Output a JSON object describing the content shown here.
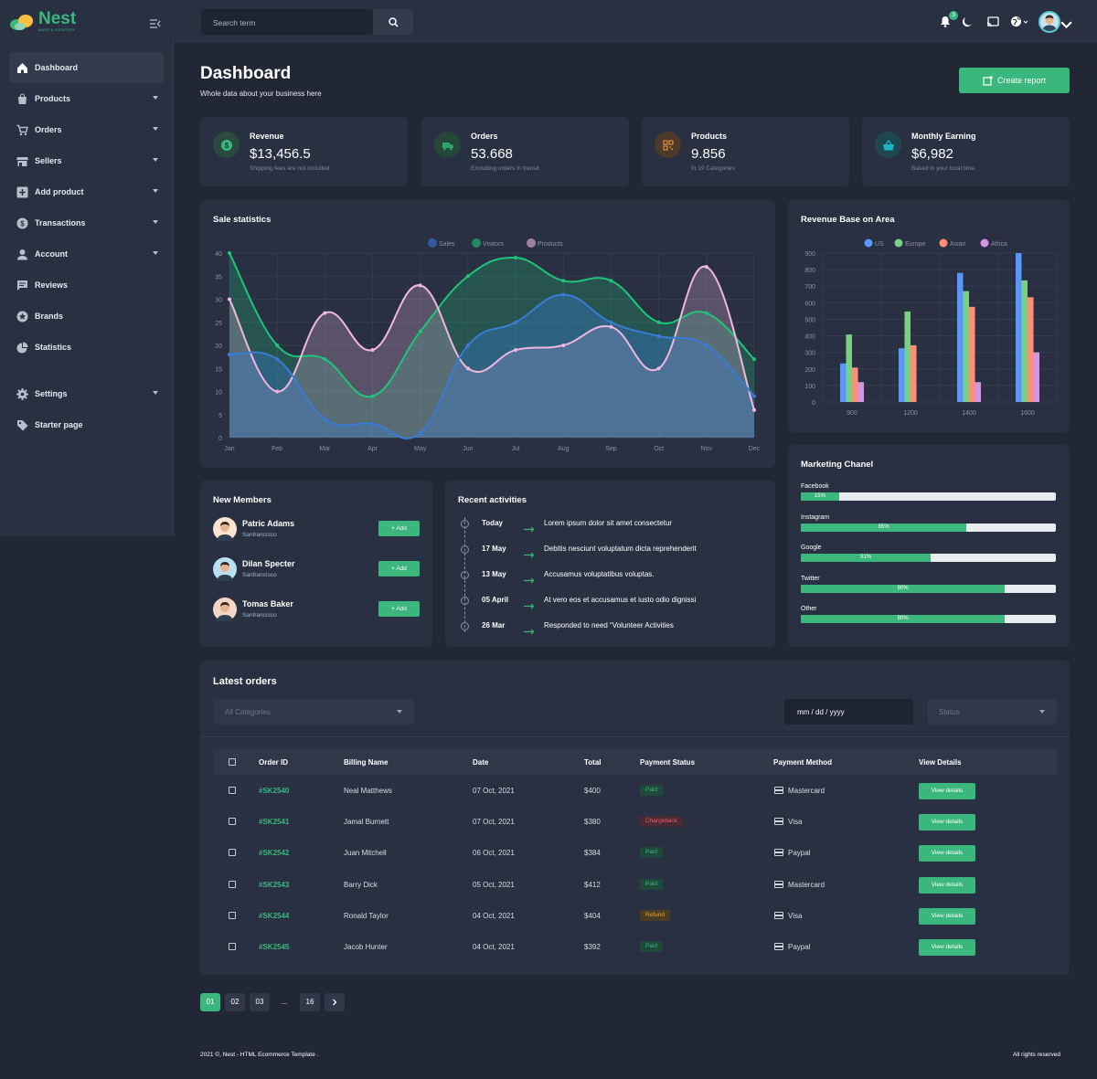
{
  "brand": {
    "name": "Nest",
    "tagline": "MART & GROCERY"
  },
  "sidebar": {
    "items": [
      {
        "label": "Dashboard",
        "icon": "home-icon",
        "active": true,
        "has_sub": false
      },
      {
        "label": "Products",
        "icon": "bag-icon",
        "has_sub": true
      },
      {
        "label": "Orders",
        "icon": "cart-icon",
        "has_sub": true
      },
      {
        "label": "Sellers",
        "icon": "store-icon",
        "has_sub": true
      },
      {
        "label": "Add product",
        "icon": "plus-box-icon",
        "has_sub": true
      },
      {
        "label": "Transactions",
        "icon": "dollar-icon",
        "has_sub": true
      },
      {
        "label": "Account",
        "icon": "person-icon",
        "has_sub": true
      },
      {
        "label": "Reviews",
        "icon": "comment-icon",
        "has_sub": false
      },
      {
        "label": "Brands",
        "icon": "star-icon",
        "has_sub": false
      },
      {
        "label": "Statistics",
        "icon": "pie-icon",
        "has_sub": false
      }
    ],
    "items2": [
      {
        "label": "Settings",
        "icon": "gear-icon",
        "has_sub": true
      },
      {
        "label": "Starter page",
        "icon": "tag-icon",
        "has_sub": false
      }
    ]
  },
  "topbar": {
    "search_placeholder": "Search term",
    "notification_count": "3"
  },
  "header": {
    "title": "Dashboard",
    "subtitle": "Whole data about your business here",
    "create_label": "Create report"
  },
  "kpis": [
    {
      "title": "Revenue",
      "value": "$13,456.5",
      "sub": "Shipping fees are not included",
      "color": "#3bb77e",
      "icon": "dollar-circle-icon"
    },
    {
      "title": "Orders",
      "value": "53.668",
      "sub": "Excluding orders in transit",
      "color": "#2ea36b",
      "icon": "truck-icon"
    },
    {
      "title": "Products",
      "value": "9.856",
      "sub": "In 19 Categories",
      "color": "#f39c3c",
      "icon": "qr-icon"
    },
    {
      "title": "Monthly Earning",
      "value": "$6,982",
      "sub": "Based in your local time.",
      "color": "#17b5c9",
      "icon": "basket-icon"
    }
  ],
  "sale_stats": {
    "title": "Sale statistics"
  },
  "revenue_area": {
    "title": "Revenue Base on Area"
  },
  "chart_data": [
    {
      "type": "area",
      "title": "Sale statistics",
      "categories": [
        "Jan",
        "Feb",
        "Mar",
        "Apr",
        "May",
        "Jun",
        "Jul",
        "Aug",
        "Sep",
        "Oct",
        "Nov",
        "Dec"
      ],
      "ylim": [
        0,
        40
      ],
      "yticks": [
        0,
        5,
        10,
        15,
        20,
        25,
        30,
        35,
        40
      ],
      "legend_position": "top-center",
      "series": [
        {
          "name": "Sales",
          "color": "#3a7bd5",
          "values": [
            18,
            17,
            4,
            3,
            1,
            20,
            25,
            31,
            25,
            22,
            20,
            9
          ]
        },
        {
          "name": "Visitors",
          "color": "#1fc47a",
          "values": [
            40,
            20,
            17,
            9,
            23,
            35,
            39,
            34,
            34,
            25,
            27,
            17
          ]
        },
        {
          "name": "Products",
          "color": "#f0b7e0",
          "values": [
            30,
            10,
            27,
            19,
            33,
            15,
            19,
            20,
            24,
            15,
            37,
            6
          ]
        }
      ]
    },
    {
      "type": "bar",
      "title": "Revenue Base on Area",
      "categories": [
        "900",
        "1200",
        "1400",
        "1600"
      ],
      "ylim": [
        0,
        900
      ],
      "yticks": [
        0,
        100,
        200,
        300,
        400,
        500,
        600,
        700,
        800,
        900
      ],
      "legend_position": "top-center",
      "series": [
        {
          "name": "US",
          "color": "#5897fb",
          "values": [
            233,
            325,
            780,
            900
          ]
        },
        {
          "name": "Europe",
          "color": "#7bcf86",
          "values": [
            408,
            547,
            670,
            735
          ]
        },
        {
          "name": "Asian",
          "color": "#ff9076",
          "values": [
            208,
            343,
            575,
            633
          ]
        },
        {
          "name": "Africa",
          "color": "#d595e5",
          "values": [
            120,
            0,
            120,
            300
          ]
        }
      ]
    }
  ],
  "members": {
    "title": "New Members",
    "add_label": "+ Add",
    "items": [
      {
        "name": "Patric Adams",
        "loc": "Sanfrancisco"
      },
      {
        "name": "Dilan Specter",
        "loc": "Sanfrancisco"
      },
      {
        "name": "Tomas Baker",
        "loc": "Sanfrancisco"
      }
    ]
  },
  "activities": {
    "title": "Recent activities",
    "items": [
      {
        "date": "Today",
        "text": "Lorem ipsum dolor sit amet consectetur"
      },
      {
        "date": "17 May",
        "text": "Debitis nesciunt voluptatum dicta reprehenderit"
      },
      {
        "date": "13 May",
        "text": "Accusamus voluptatibus voluptas."
      },
      {
        "date": "05 April",
        "text": "At vero eos et accusamus et iusto odio dignissi"
      },
      {
        "date": "26 Mar",
        "text": "Responded to need “Volunteer Activities"
      }
    ]
  },
  "marketing": {
    "title": "Marketing Chanel",
    "items": [
      {
        "label": "Facebook",
        "pct": 15,
        "text": "15%"
      },
      {
        "label": "Instagram",
        "pct": 65,
        "text": "65%"
      },
      {
        "label": "Google",
        "pct": 51,
        "text": "51%"
      },
      {
        "label": "Twitter",
        "pct": 80,
        "text": "80%"
      },
      {
        "label": "Other",
        "pct": 80,
        "text": "80%"
      }
    ]
  },
  "orders": {
    "title": "Latest orders",
    "filters": {
      "category": "All Categories",
      "date": "mm / dd / yyyy",
      "status": "Status"
    },
    "columns": [
      "Order ID",
      "Billing Name",
      "Date",
      "Total",
      "Payment Status",
      "Payment Method",
      "View Details"
    ],
    "view_label": "View details",
    "rows": [
      {
        "id": "#SK2540",
        "name": "Neal Matthews",
        "date": "07 Oct, 2021",
        "total": "$400",
        "status": "Paid",
        "method": "Mastercard"
      },
      {
        "id": "#SK2541",
        "name": "Jamal Burnett",
        "date": "07 Oct, 2021",
        "total": "$380",
        "status": "Chargeback",
        "method": "Visa"
      },
      {
        "id": "#SK2542",
        "name": "Juan Mitchell",
        "date": "06 Oct, 2021",
        "total": "$384",
        "status": "Paid",
        "method": "Paypal"
      },
      {
        "id": "#SK2543",
        "name": "Barry Dick",
        "date": "05 Oct, 2021",
        "total": "$412",
        "status": "Paid",
        "method": "Mastercard"
      },
      {
        "id": "#SK2544",
        "name": "Ronald Taylor",
        "date": "04 Oct, 2021",
        "total": "$404",
        "status": "Refund",
        "method": "Visa"
      },
      {
        "id": "#SK2545",
        "name": "Jacob Hunter",
        "date": "04 Oct, 2021",
        "total": "$392",
        "status": "Paid",
        "method": "Paypal"
      }
    ],
    "status_colors": {
      "Paid": [
        "#1f4a3b",
        "#3bb77e"
      ],
      "Chargeback": [
        "#4a2a33",
        "#ef5a6f"
      ],
      "Refund": [
        "#4a3d22",
        "#f5a524"
      ]
    }
  },
  "pagination": {
    "pages": [
      "01",
      "02",
      "03",
      "...",
      "16"
    ],
    "active": "01"
  },
  "footer": {
    "left": "2021 ©, Nest - HTML Ecommerce Template .",
    "right": "All rights reserved"
  }
}
